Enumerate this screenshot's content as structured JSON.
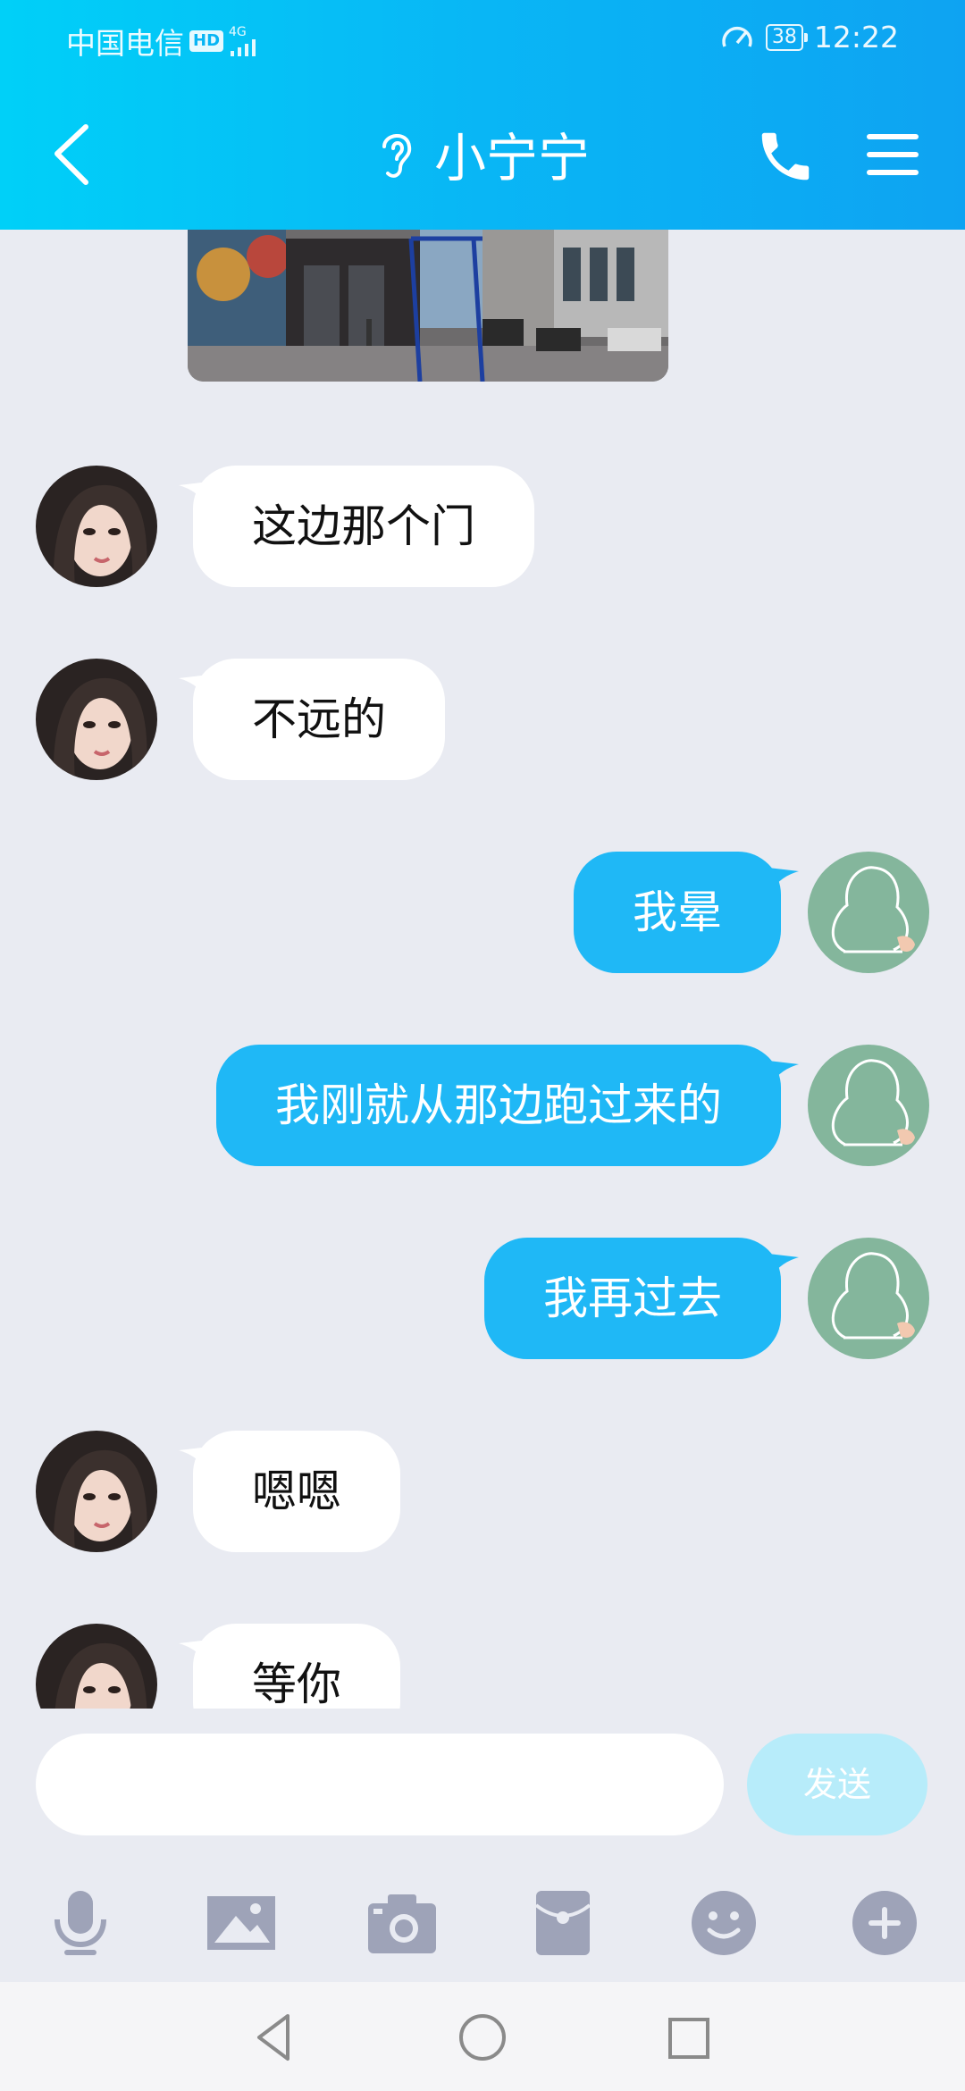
{
  "status_bar": {
    "carrier": "中国电信",
    "hd": "HD",
    "network": "4G",
    "battery": "38",
    "time": "12:22"
  },
  "header": {
    "title": "小宁宁",
    "back_icon": "chevron-left-icon",
    "mode_icon": "ear-icon",
    "call_icon": "phone-icon",
    "menu_icon": "menu-icon"
  },
  "messages": [
    {
      "side": "in",
      "text": "这边那个门"
    },
    {
      "side": "in",
      "text": "不远的"
    },
    {
      "side": "out",
      "text": "我晕"
    },
    {
      "side": "out",
      "text": "我刚就从那边跑过来的"
    },
    {
      "side": "out",
      "text": "我再过去"
    },
    {
      "side": "in",
      "text": "嗯嗯"
    },
    {
      "side": "in",
      "text": "等你"
    }
  ],
  "input": {
    "placeholder": "",
    "send_label": "发送"
  },
  "toolbar": [
    "microphone-icon",
    "image-icon",
    "camera-icon",
    "red-envelope-icon",
    "emoji-icon",
    "plus-icon"
  ],
  "navbar": [
    "back-triangle-icon",
    "home-circle-icon",
    "recents-square-icon"
  ],
  "colors": {
    "header_start": "#00d0f8",
    "header_end": "#0ea3f2",
    "outgoing_bubble": "#1fb8f6",
    "incoming_bubble": "#ffffff",
    "chat_background": "#e9ebf2",
    "send_button": "#b7ecfa",
    "toolbar_icon": "#9ea3b8"
  }
}
